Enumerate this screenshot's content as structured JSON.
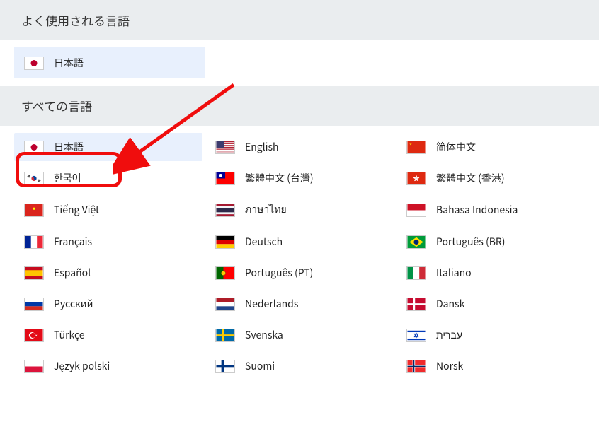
{
  "headers": {
    "frequently_used": "よく使用される言語",
    "all_languages": "すべての言語"
  },
  "frequent": [
    {
      "id": "ja",
      "label": "日本語",
      "flag": "jp",
      "selected": true
    }
  ],
  "all": [
    {
      "id": "ja",
      "label": "日本語",
      "flag": "jp",
      "selected": true
    },
    {
      "id": "en",
      "label": "English",
      "flag": "us"
    },
    {
      "id": "zh-cn",
      "label": "简体中文",
      "flag": "cn"
    },
    {
      "id": "ko",
      "label": "한국어",
      "flag": "kr"
    },
    {
      "id": "zh-tw",
      "label": "繁體中文 (台灣)",
      "flag": "tw"
    },
    {
      "id": "zh-hk",
      "label": "繁體中文 (香港)",
      "flag": "hk"
    },
    {
      "id": "vi",
      "label": "Tiếng Việt",
      "flag": "vn"
    },
    {
      "id": "th",
      "label": "ภาษาไทย",
      "flag": "th"
    },
    {
      "id": "id",
      "label": "Bahasa Indonesia",
      "flag": "id"
    },
    {
      "id": "fr",
      "label": "Français",
      "flag": "fr"
    },
    {
      "id": "de",
      "label": "Deutsch",
      "flag": "de"
    },
    {
      "id": "pt-br",
      "label": "Português (BR)",
      "flag": "br"
    },
    {
      "id": "es",
      "label": "Español",
      "flag": "es"
    },
    {
      "id": "pt",
      "label": "Português (PT)",
      "flag": "pt"
    },
    {
      "id": "it",
      "label": "Italiano",
      "flag": "it"
    },
    {
      "id": "ru",
      "label": "Русский",
      "flag": "ru"
    },
    {
      "id": "nl",
      "label": "Nederlands",
      "flag": "nl"
    },
    {
      "id": "da",
      "label": "Dansk",
      "flag": "dk"
    },
    {
      "id": "tr",
      "label": "Türkçe",
      "flag": "tr"
    },
    {
      "id": "sv",
      "label": "Svenska",
      "flag": "se"
    },
    {
      "id": "he",
      "label": "עברית",
      "flag": "il"
    },
    {
      "id": "pl",
      "label": "Język polski",
      "flag": "pl"
    },
    {
      "id": "fi",
      "label": "Suomi",
      "flag": "fi"
    },
    {
      "id": "no",
      "label": "Norsk",
      "flag": "no"
    }
  ],
  "annotation": {
    "highlight_target": "ja",
    "arrow": true
  }
}
